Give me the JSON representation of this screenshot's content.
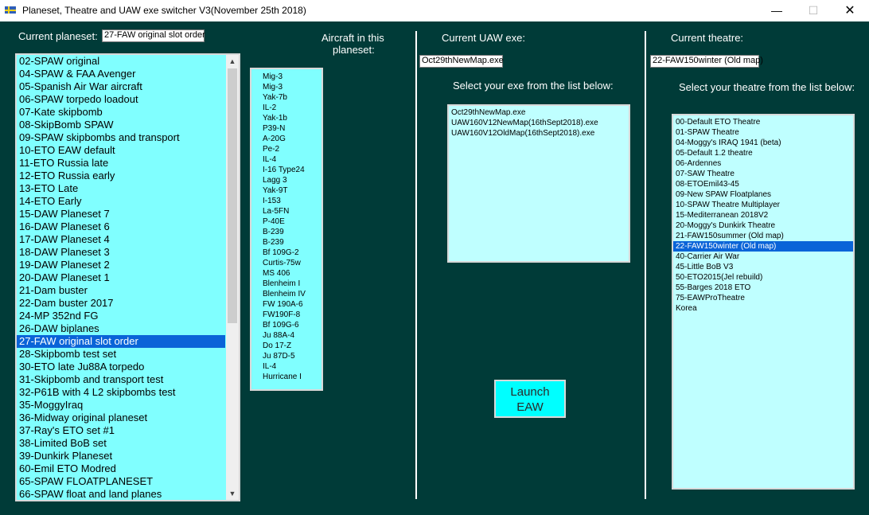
{
  "window": {
    "title": "Planeset, Theatre and UAW exe switcher V3(November 25th 2018)",
    "minimize_glyph": "—",
    "maximize_glyph": "☐",
    "close_glyph": "✕"
  },
  "planeset": {
    "label": "Current planeset:",
    "current": "27-FAW original slot  order",
    "items": [
      "02-SPAW original",
      "04-SPAW & FAA Avenger",
      "05-Spanish Air War aircraft",
      "06-SPAW torpedo loadout",
      "07-Kate skipbomb",
      "08-SkipBomb SPAW",
      "09-SPAW skipbombs and transport",
      "10-ETO EAW default",
      "11-ETO Russia late",
      "12-ETO Russia early",
      "13-ETO Late",
      "14-ETO Early",
      "15-DAW Planeset 7",
      "16-DAW Planeset 6",
      "17-DAW Planeset 4",
      "18-DAW Planeset 3",
      "19-DAW Planeset 2",
      "20-DAW Planeset 1",
      "21-Dam buster",
      "22-Dam buster 2017",
      "24-MP 352nd FG",
      "26-DAW biplanes",
      "27-FAW original slot  order",
      "28-Skipbomb test set",
      "30-ETO late Ju88A torpedo",
      "31-Skipbomb and transport test",
      "32-P61B with 4 L2 skipbombs test",
      "35-MoggyIraq",
      "36-Midway original planeset",
      "37-Ray's ETO set #1",
      "38-Limited BoB set",
      "39-Dunkirk Planeset",
      "60-Emil ETO Modred",
      "65-SPAW FLOATPLANESET",
      "66-SPAW float and land planes"
    ],
    "selected_index": 22,
    "scroll_up_glyph": "▲",
    "scroll_down_glyph": "▼"
  },
  "aircraft": {
    "label_line1": "Aircraft in this",
    "label_line2": "planeset:",
    "items": [
      "Mig-3",
      "Mig-3",
      "Yak-7b",
      "IL-2",
      "Yak-1b",
      "P39-N",
      "A-20G",
      "Pe-2",
      "IL-4",
      "I-16 Type24",
      "Lagg 3",
      "Yak-9T",
      "I-153",
      "La-5FN",
      "P-40E",
      "B-239",
      "B-239",
      "Bf 109G-2",
      "Curtis-75w",
      "MS 406",
      "Blenheim I",
      "Blenheim IV",
      "FW 190A-6",
      "FW190F-8",
      "Bf 109G-6",
      "Ju 88A-4",
      "Do 17-Z",
      "Ju 87D-5",
      "IL-4",
      "Hurricane I"
    ]
  },
  "uaw": {
    "label": "Current UAW exe:",
    "current": "Oct29thNewMap.exe",
    "select_label": "Select your exe from the list below:",
    "items": [
      "Oct29thNewMap.exe",
      "UAW160V12NewMap(16thSept2018).exe",
      "UAW160V12OldMap(16thSept2018).exe"
    ],
    "launch_line1": "Launch",
    "launch_line2": "EAW"
  },
  "theatre": {
    "label": "Current theatre:",
    "current": "22-FAW150winter (Old map)",
    "select_label": "Select your theatre from the list below:",
    "items": [
      "00-Default ETO Theatre",
      "01-SPAW Theatre",
      "04-Moggy's IRAQ 1941 (beta)",
      "05-Default 1.2 theatre",
      "06-Ardennes",
      "07-SAW Theatre",
      "08-ETOEmil43-45",
      "09-New SPAW Floatplanes",
      "10-SPAW Theatre Multiplayer",
      "15-Mediterranean 2018V2",
      "20-Moggy's Dunkirk Theatre",
      "21-FAW150summer (Old map)",
      "22-FAW150winter (Old map)",
      "40-Carrier Air War",
      "45-Little BoB V3",
      "50-ETO2015(Jel rebuild)",
      "55-Barges 2018 ETO",
      "75-EAWProTheatre",
      "Korea"
    ],
    "selected_index": 12
  },
  "colors": {
    "background": "#003b38",
    "list_cyan": "#80ffff",
    "list_light": "#bfffff",
    "selection": "#0a64d8",
    "button": "#00ffff"
  }
}
